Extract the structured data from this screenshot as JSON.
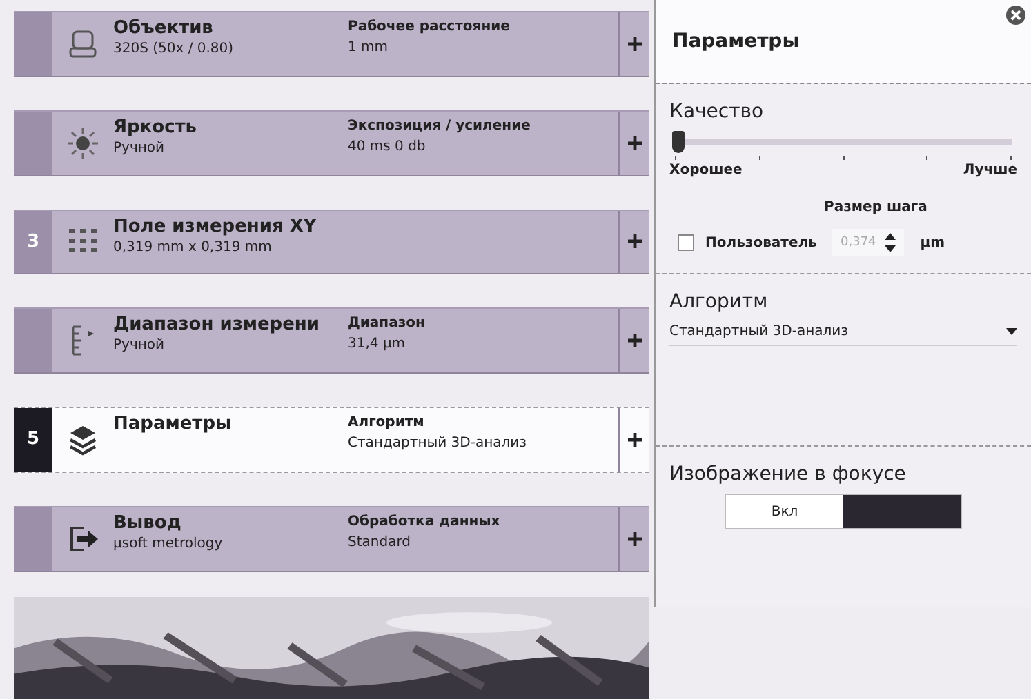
{
  "steps": [
    {
      "title": "Объектив",
      "subtitle": "320S (50x / 0.80)",
      "detail_label": "Рабочее расстояние",
      "detail_value": "1 mm",
      "kind": "lens",
      "selected": false
    },
    {
      "title": "Яркость",
      "subtitle": "Ручной",
      "detail_label": "Экспозиция / усиление",
      "detail_value": "40 ms  0 db",
      "kind": "sun",
      "selected": false
    },
    {
      "number": "3",
      "title": "Поле измерения XY",
      "subtitle": "0,319 mm x 0,319 mm",
      "kind": "grid",
      "selected": false
    },
    {
      "title": "Диапазон измерени",
      "subtitle": "Ручной",
      "detail_label": "Диапазон",
      "detail_value": "31,4 µm",
      "kind": "range",
      "selected": false
    },
    {
      "number": "5",
      "title": "Параметры",
      "detail_label": "Алгоритм",
      "detail_value": "Стандартный 3D-анализ",
      "kind": "layers",
      "selected": true
    },
    {
      "title": "Вывод",
      "subtitle": "µsoft metrology",
      "detail_label": "Обработка данных",
      "detail_value": "Standard",
      "kind": "exit",
      "selected": false
    }
  ],
  "panel": {
    "title": "Параметры",
    "quality": {
      "label": "Качество",
      "level": 0,
      "min_label": "Хорошее",
      "max_label": "Лучше"
    },
    "step_size": {
      "label": "Размер шага",
      "custom_label": "Пользователь",
      "custom_checked": false,
      "value": "0,374",
      "disabled": true,
      "unit": "µm"
    },
    "algorithm": {
      "label": "Алгоритм",
      "value": "Стандартный 3D-анализ"
    },
    "focus_image": {
      "label": "Изображение в фокусе",
      "toggle_label": "Вкл",
      "on": true
    }
  }
}
